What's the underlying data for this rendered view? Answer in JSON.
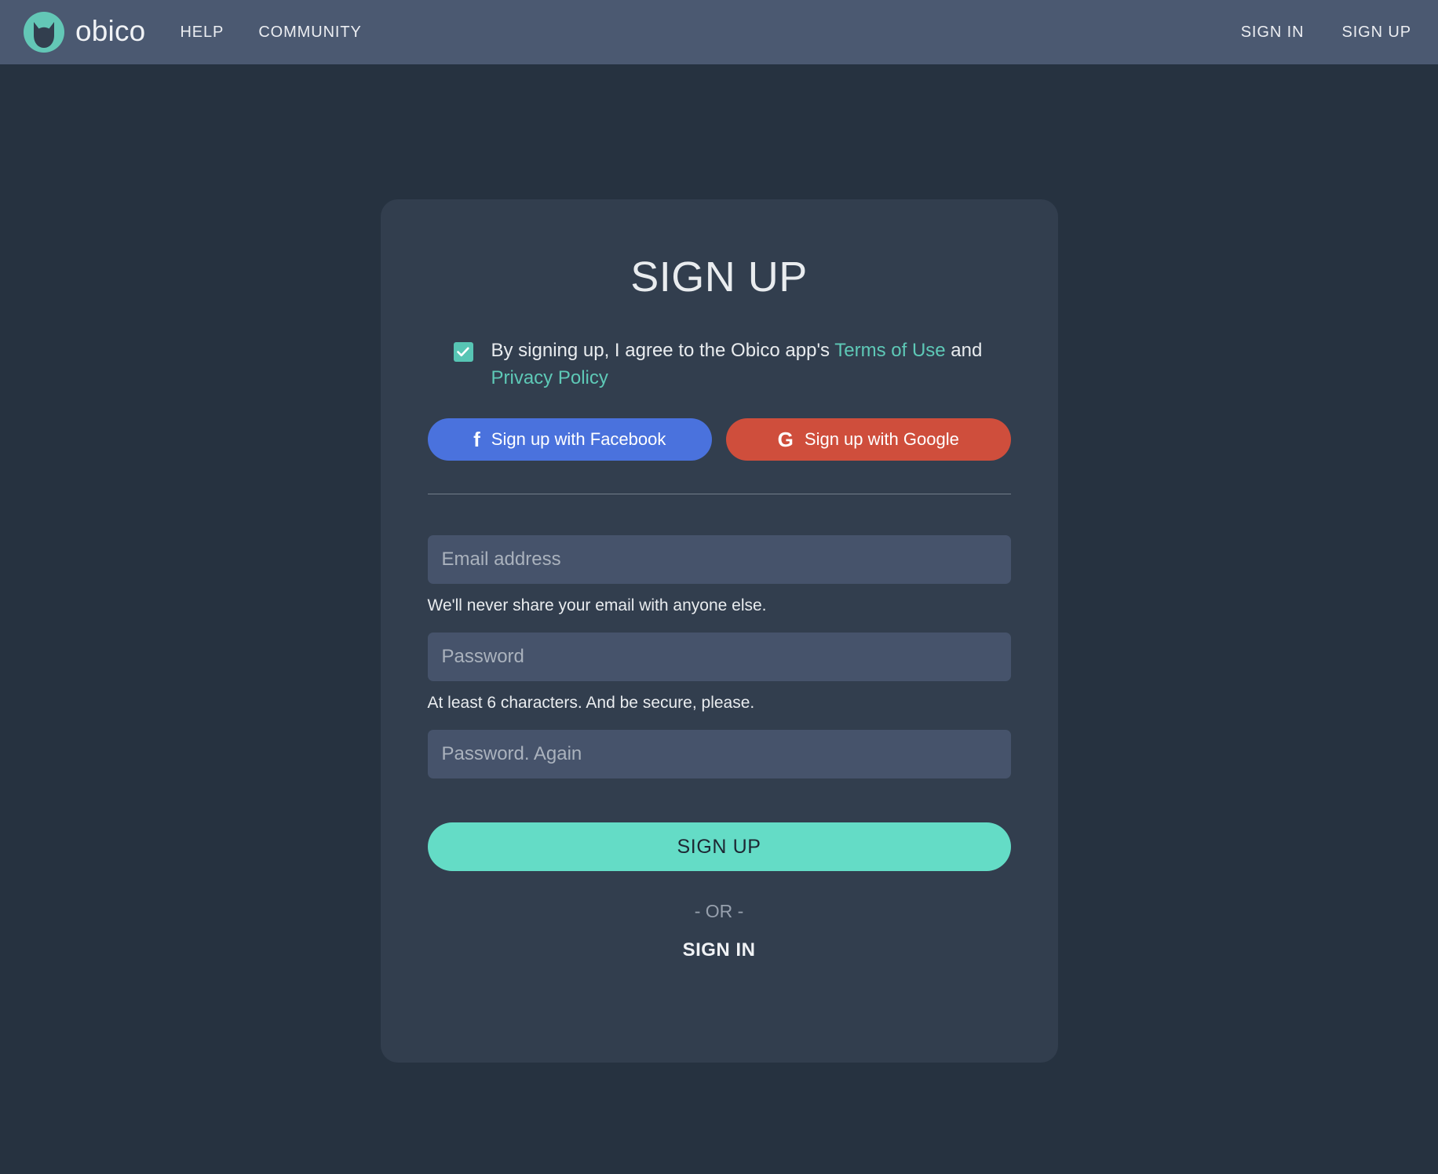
{
  "header": {
    "brand_name": "obico",
    "logo_icon": "obico-cat-logo-icon",
    "nav_links": [
      {
        "label": "HELP"
      },
      {
        "label": "COMMUNITY"
      }
    ],
    "right_links": [
      {
        "label": "SIGN IN"
      },
      {
        "label": "SIGN UP"
      }
    ]
  },
  "card": {
    "title": "SIGN UP",
    "terms": {
      "checked": true,
      "checkbox_icon": "check-icon",
      "text_before": "By signing up, I agree to the Obico app's ",
      "terms_link": "Terms of Use",
      "text_middle": " and ",
      "privacy_link": "Privacy Policy"
    },
    "social_buttons": [
      {
        "label": "Sign up with Facebook",
        "icon": "facebook-icon",
        "glyph": "f",
        "color": "#4a72dd"
      },
      {
        "label": "Sign up with Google",
        "icon": "google-icon",
        "glyph": "G",
        "color": "#cf4e3c"
      }
    ],
    "form": {
      "email": {
        "placeholder": "Email address",
        "value": "",
        "help": "We'll never share your email with anyone else."
      },
      "password": {
        "placeholder": "Password",
        "value": "",
        "help": "At least 6 characters. And be secure, please."
      },
      "password_confirm": {
        "placeholder": "Password. Again",
        "value": ""
      },
      "submit_label": "SIGN UP"
    },
    "or_label": "- OR -",
    "signin_label": "SIGN IN"
  },
  "colors": {
    "page_bg": "#263240",
    "header_bg": "#4b5971",
    "card_bg": "#323e4e",
    "input_bg": "#46536b",
    "accent_teal": "#64dcc6",
    "link_teal": "#5ec9b7",
    "facebook_blue": "#4a72dd",
    "google_red": "#cf4e3c"
  }
}
